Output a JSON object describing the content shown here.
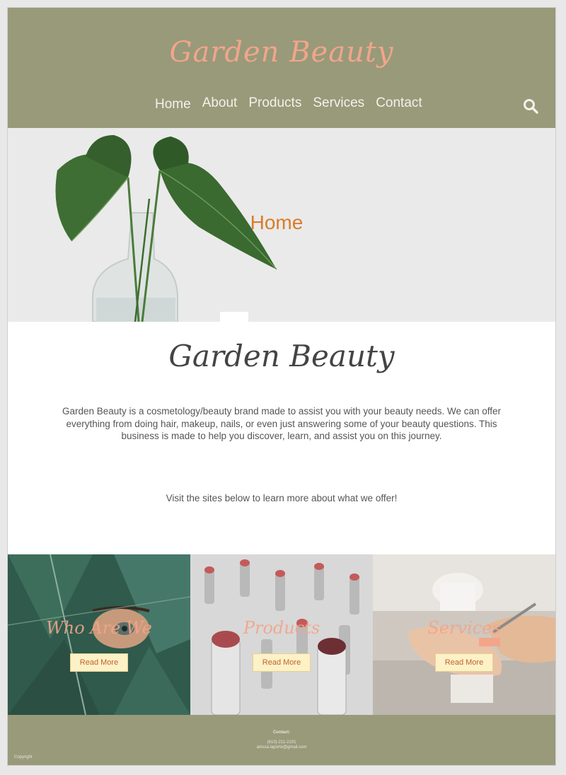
{
  "header": {
    "logo_text": "Garden Beauty",
    "nav": [
      {
        "label": "Home"
      },
      {
        "label": "About"
      },
      {
        "label": "Products"
      },
      {
        "label": "Services"
      },
      {
        "label": "Contact"
      }
    ],
    "search_icon": "search-icon"
  },
  "hero": {
    "title": "Home"
  },
  "about": {
    "brand_script": "Garden Beauty",
    "intro": "Garden Beauty is a cosmetology/beauty brand made to assist you with your beauty needs. We can offer everything from doing hair, makeup, nails, or even just answering some of your beauty questions. This business is made to help you discover, learn, and assist you on this journey.",
    "visit": "Visit the sites below to learn more about what we offer!"
  },
  "tiles": [
    {
      "title": "Who Are We",
      "button": "Read More"
    },
    {
      "title": "Products",
      "button": "Read More"
    },
    {
      "title": "Services",
      "button": "Read More"
    }
  ],
  "footer": {
    "contact_label": "Contact:",
    "phone": "(610)-211-2101",
    "email": "anissa.laporte@gmail.com",
    "copyright": "Copyright"
  },
  "colors": {
    "header_bg": "#989a7a",
    "accent_peach": "#f2a58a",
    "hero_title": "#d97c2b",
    "button_bg": "#fdf1c7"
  }
}
